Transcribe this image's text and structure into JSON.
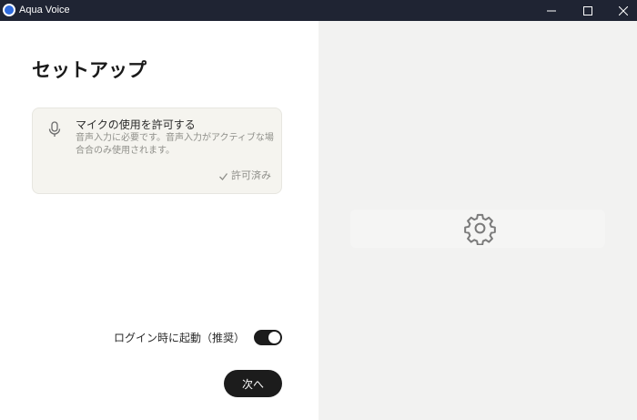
{
  "titlebar": {
    "app_name": "Aqua Voice",
    "icons": [
      "app-logo-icon",
      "minimize-icon",
      "maximize-icon",
      "close-icon"
    ]
  },
  "setup": {
    "title": "セットアップ",
    "permission": {
      "icon": "microphone-icon",
      "title": "マイクの使用を許可する",
      "description": "音声入力に必要です。音声入力がアクティブな場合合のみ使用されます。",
      "status_icon": "check-icon",
      "status": "許可済み"
    },
    "launch_at_login": {
      "label": "ログイン時に起動（推奨）",
      "enabled": true
    },
    "next_button": "次へ"
  },
  "preview": {
    "icon": "gear-icon"
  },
  "colors": {
    "titlebar_bg": "#1f2433",
    "accent": "#1c1c1c",
    "card_bg": "#f5f4ef",
    "preview_bg": "#f2f2f1"
  }
}
